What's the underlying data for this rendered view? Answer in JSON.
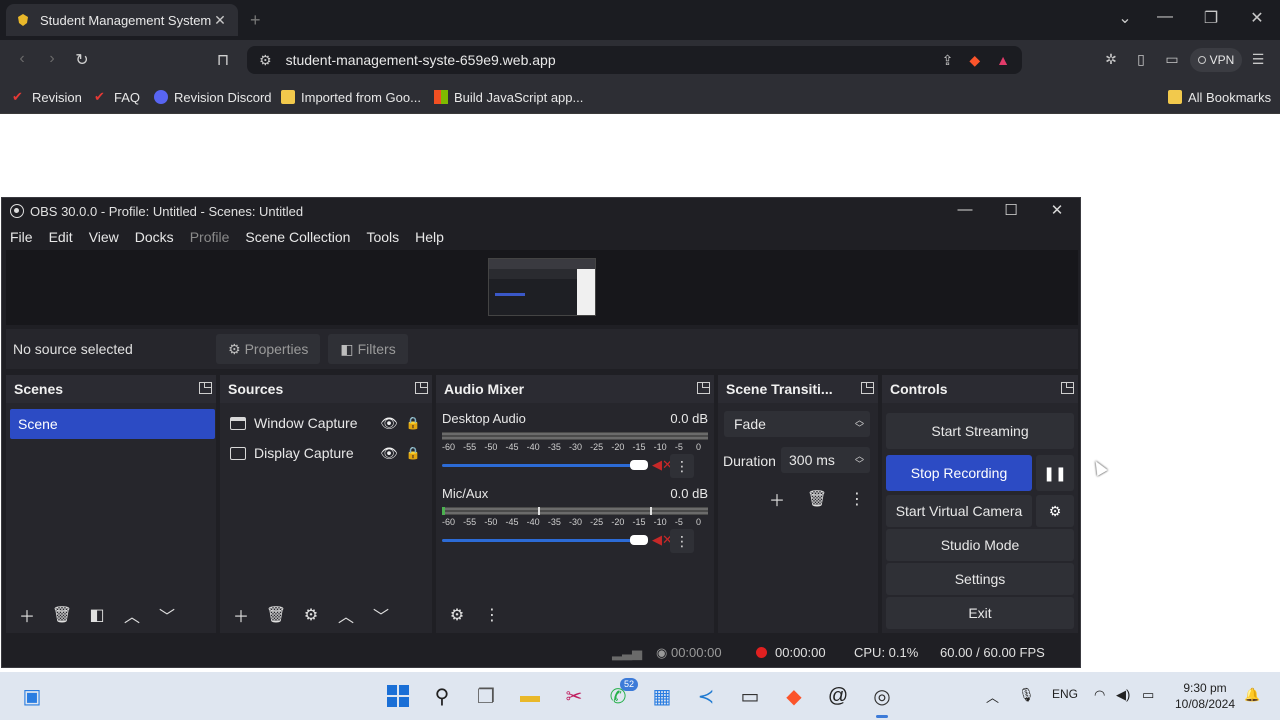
{
  "browser": {
    "tab_title": "Student Management System",
    "url": "student-management-syste-659e9.web.app",
    "vpn_label": "VPN",
    "bookmarks": [
      "Revision",
      "FAQ",
      "Revision Discord",
      "Imported from Goo...",
      "Build JavaScript app..."
    ],
    "all_bookmarks": "All Bookmarks"
  },
  "obs": {
    "title": "OBS 30.0.0 - Profile: Untitled - Scenes: Untitled",
    "menu": [
      "File",
      "Edit",
      "View",
      "Docks",
      "Profile",
      "Scene Collection",
      "Tools",
      "Help"
    ],
    "no_source": "No source selected",
    "properties_label": "Properties",
    "filters_label": "Filters",
    "docks": {
      "scenes": {
        "title": "Scenes",
        "items": [
          "Scene"
        ]
      },
      "sources": {
        "title": "Sources",
        "items": [
          "Window Capture",
          "Display Capture"
        ]
      },
      "mixer": {
        "title": "Audio Mixer",
        "channels": [
          {
            "name": "Desktop Audio",
            "level": "0.0 dB",
            "volume": 1.0
          },
          {
            "name": "Mic/Aux",
            "level": "0.0 dB",
            "volume": 1.0
          }
        ],
        "scale": [
          "-60",
          "-55",
          "-50",
          "-45",
          "-40",
          "-35",
          "-30",
          "-25",
          "-20",
          "-15",
          "-10",
          "-5",
          "0"
        ]
      },
      "transitions": {
        "title": "Scene Transiti...",
        "selected": "Fade",
        "duration_label": "Duration",
        "duration_value": "300 ms"
      },
      "controls": {
        "title": "Controls",
        "start_streaming": "Start Streaming",
        "stop_recording": "Stop Recording",
        "start_virtual_camera": "Start Virtual Camera",
        "studio_mode": "Studio Mode",
        "settings": "Settings",
        "exit": "Exit"
      }
    },
    "status": {
      "stream_time": "00:00:00",
      "record_time": "00:00:00",
      "cpu": "CPU: 0.1%",
      "fps": "60.00 / 60.00 FPS"
    }
  },
  "taskbar": {
    "whatsapp_badge": "52",
    "language": "ENG",
    "time": "9:30 pm",
    "date": "10/08/2024"
  }
}
